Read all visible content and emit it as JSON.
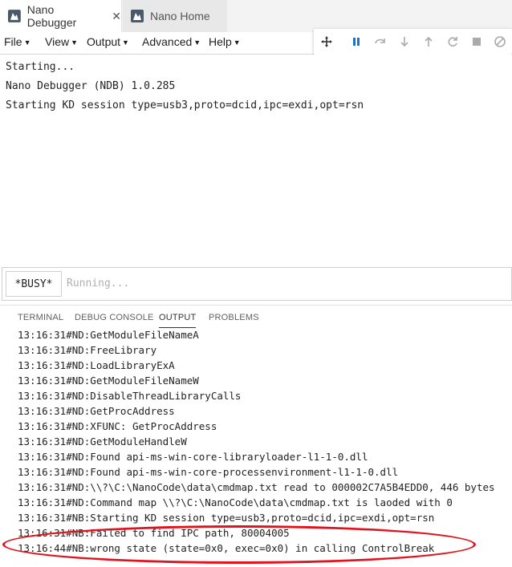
{
  "tabs": [
    {
      "label": "Nano Debugger",
      "active": true
    },
    {
      "label": "Nano Home",
      "active": false
    }
  ],
  "menu": [
    "File",
    "View",
    "Output",
    "Advanced",
    "Help"
  ],
  "debug_toolbar": [
    "move-handle-icon",
    "pause-icon",
    "step-over-icon",
    "step-into-icon",
    "step-out-icon",
    "restart-icon",
    "stop-icon",
    "disconnect-icon"
  ],
  "console": {
    "lines": [
      "Starting...",
      "Nano Debugger (NDB) 1.0.285",
      "Starting KD session type=usb3,proto=dcid,ipc=exdi,opt=rsn"
    ]
  },
  "command": {
    "status": "*BUSY*",
    "placeholder": "Running..."
  },
  "panel_tabs": [
    "TERMINAL",
    "DEBUG CONSOLE",
    "OUTPUT",
    "PROBLEMS"
  ],
  "active_panel_tab": "OUTPUT",
  "output": {
    "lines": [
      "13:16:31#ND:GetModuleFileNameA",
      "13:16:31#ND:FreeLibrary",
      "13:16:31#ND:LoadLibraryExA",
      "13:16:31#ND:GetModuleFileNameW",
      "13:16:31#ND:DisableThreadLibraryCalls",
      "13:16:31#ND:GetProcAddress",
      "13:16:31#ND:XFUNC: GetProcAddress",
      "13:16:31#ND:GetModuleHandleW",
      "13:16:31#ND:Found api-ms-win-core-libraryloader-l1-1-0.dll",
      "13:16:31#ND:Found api-ms-win-core-processenvironment-l1-1-0.dll",
      "13:16:31#ND:\\\\?\\C:\\NanoCode\\data\\cmdmap.txt read to 000002C7A5B4EDD0, 446 bytes",
      "13:16:31#ND:Command map \\\\?\\C:\\NanoCode\\data\\cmdmap.txt is laoded with 0",
      "13:16:31#NB:Starting KD session type=usb3,proto=dcid,ipc=exdi,opt=rsn",
      "13:16:31#NB:Failed to find IPC path, 80004005",
      "13:16:44#NB:wrong state (state=0x0, exec=0x0) in calling ControlBreak"
    ]
  },
  "colors": {
    "accent": "#1a73c8",
    "highlight": "#e0141e"
  }
}
